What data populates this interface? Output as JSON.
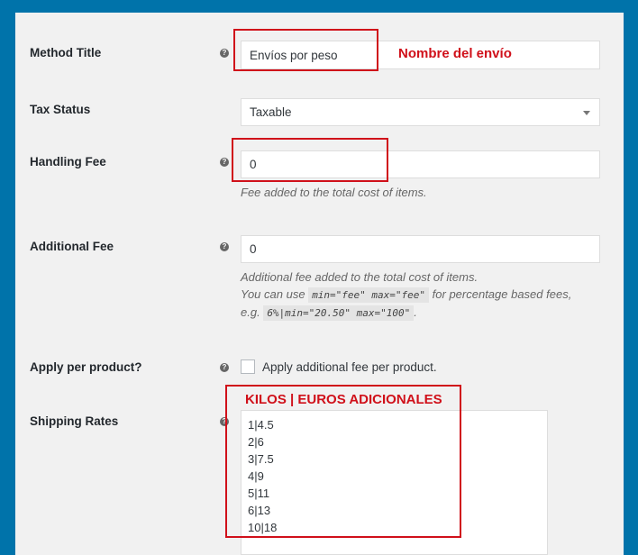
{
  "form": {
    "method_title": {
      "label": "Method Title",
      "value": "Envíos por peso",
      "annotation": "Nombre del envío"
    },
    "tax_status": {
      "label": "Tax Status",
      "value": "Taxable"
    },
    "handling_fee": {
      "label": "Handling Fee",
      "value": "0",
      "description": "Fee added to the total cost of items."
    },
    "additional_fee": {
      "label": "Additional Fee",
      "value": "0",
      "description_line1": "Additional fee added to the total cost of items.",
      "description_line2_prefix": "You can use",
      "code1": "min=\"fee\" max=\"fee\"",
      "description_line2_suffix": "for percentage based fees,",
      "description_line3_prefix": "e.g.",
      "code2": "6%|min=\"20.50\" max=\"100\"",
      "description_line3_suffix": "."
    },
    "apply_per_product": {
      "label": "Apply per product?",
      "checkbox_label": "Apply additional fee per product.",
      "checked": false
    },
    "shipping_rates": {
      "label": "Shipping Rates",
      "annotation": "KILOS | EUROS ADICIONALES",
      "lines": [
        "1|4.5",
        "2|6",
        "3|7.5",
        "4|9",
        "5|11",
        "6|13",
        "10|18"
      ]
    }
  },
  "help_glyph": "?",
  "colors": {
    "page_background": "#0073aa",
    "panel_background": "#f1f1f1",
    "annotation_red": "#d0101a"
  }
}
